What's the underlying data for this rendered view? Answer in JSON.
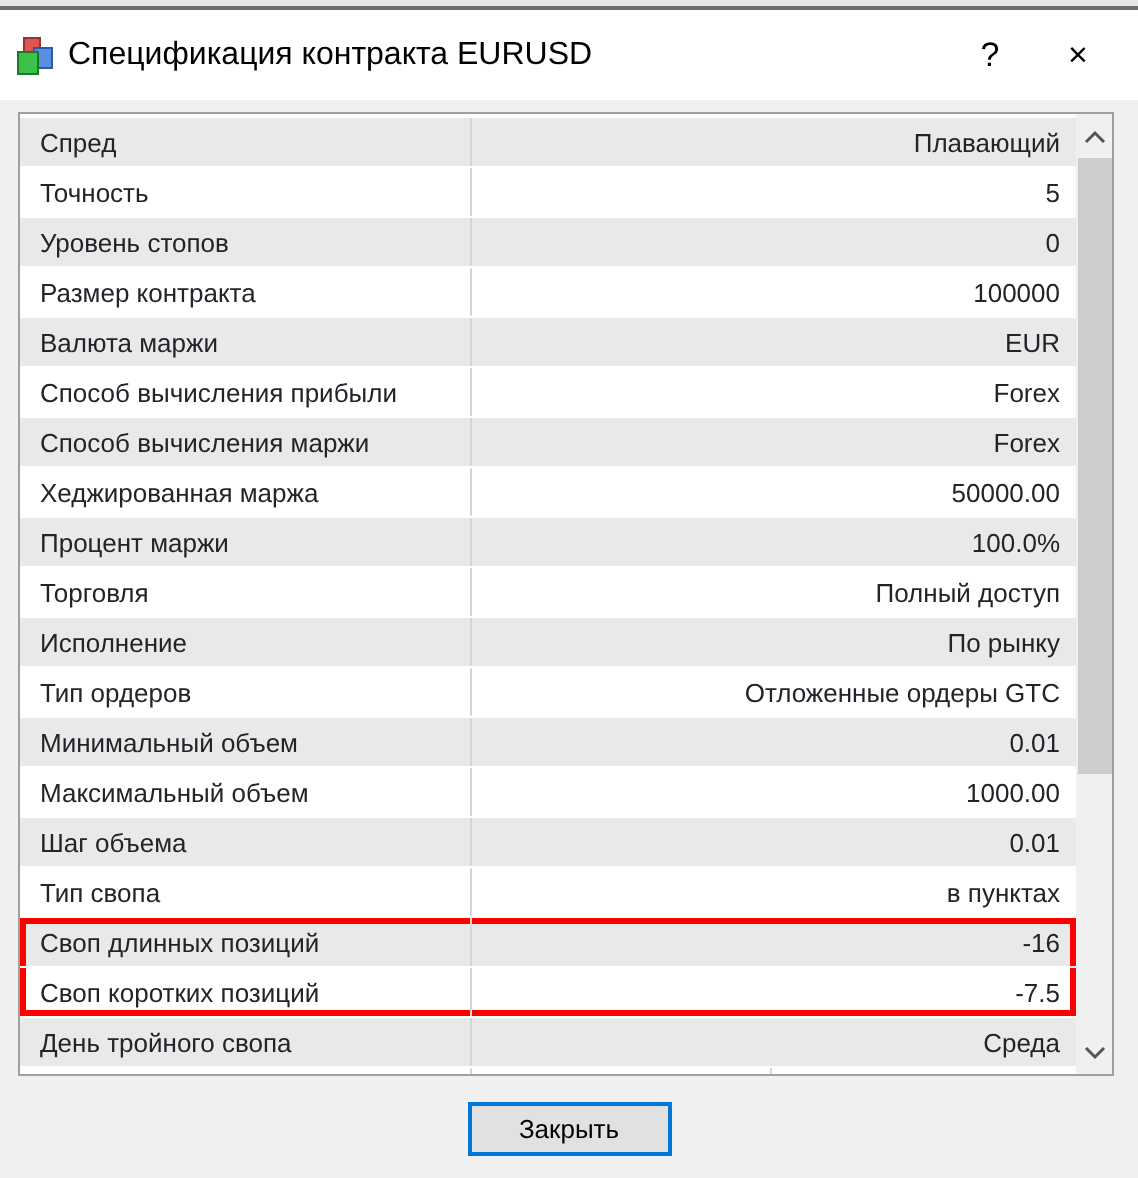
{
  "window": {
    "title": "Спецификация контракта EURUSD",
    "help": "?",
    "close": "×"
  },
  "rows": [
    {
      "name": "Спред",
      "value": "Плавающий",
      "highlighted": false
    },
    {
      "name": "Точность",
      "value": "5",
      "highlighted": false
    },
    {
      "name": "Уровень стопов",
      "value": "0",
      "highlighted": false
    },
    {
      "name": "Размер контракта",
      "value": "100000",
      "highlighted": false
    },
    {
      "name": "Валюта маржи",
      "value": "EUR",
      "highlighted": false
    },
    {
      "name": "Способ вычисления прибыли",
      "value": "Forex",
      "highlighted": false
    },
    {
      "name": "Способ вычисления маржи",
      "value": "Forex",
      "highlighted": false
    },
    {
      "name": "Хеджированная маржа",
      "value": "50000.00",
      "highlighted": false
    },
    {
      "name": "Процент маржи",
      "value": "100.0%",
      "highlighted": false
    },
    {
      "name": "Торговля",
      "value": "Полный доступ",
      "highlighted": false
    },
    {
      "name": "Исполнение",
      "value": "По рынку",
      "highlighted": false
    },
    {
      "name": "Тип ордеров",
      "value": "Отложенные ордеры GTC",
      "highlighted": false
    },
    {
      "name": "Минимальный объем",
      "value": "0.01",
      "highlighted": false
    },
    {
      "name": "Максимальный объем",
      "value": "1000.00",
      "highlighted": false
    },
    {
      "name": "Шаг объема",
      "value": "0.01",
      "highlighted": false
    },
    {
      "name": "Тип свопа",
      "value": "в пунктах",
      "highlighted": false
    },
    {
      "name": "Своп длинных позиций",
      "value": "-16",
      "highlighted": true
    },
    {
      "name": "Своп коротких позиций",
      "value": "-7.5",
      "highlighted": true
    },
    {
      "name": "День тройного свопа",
      "value": "Среда",
      "highlighted": false
    }
  ],
  "buttons": [
    {
      "label": "Закрыть"
    }
  ]
}
